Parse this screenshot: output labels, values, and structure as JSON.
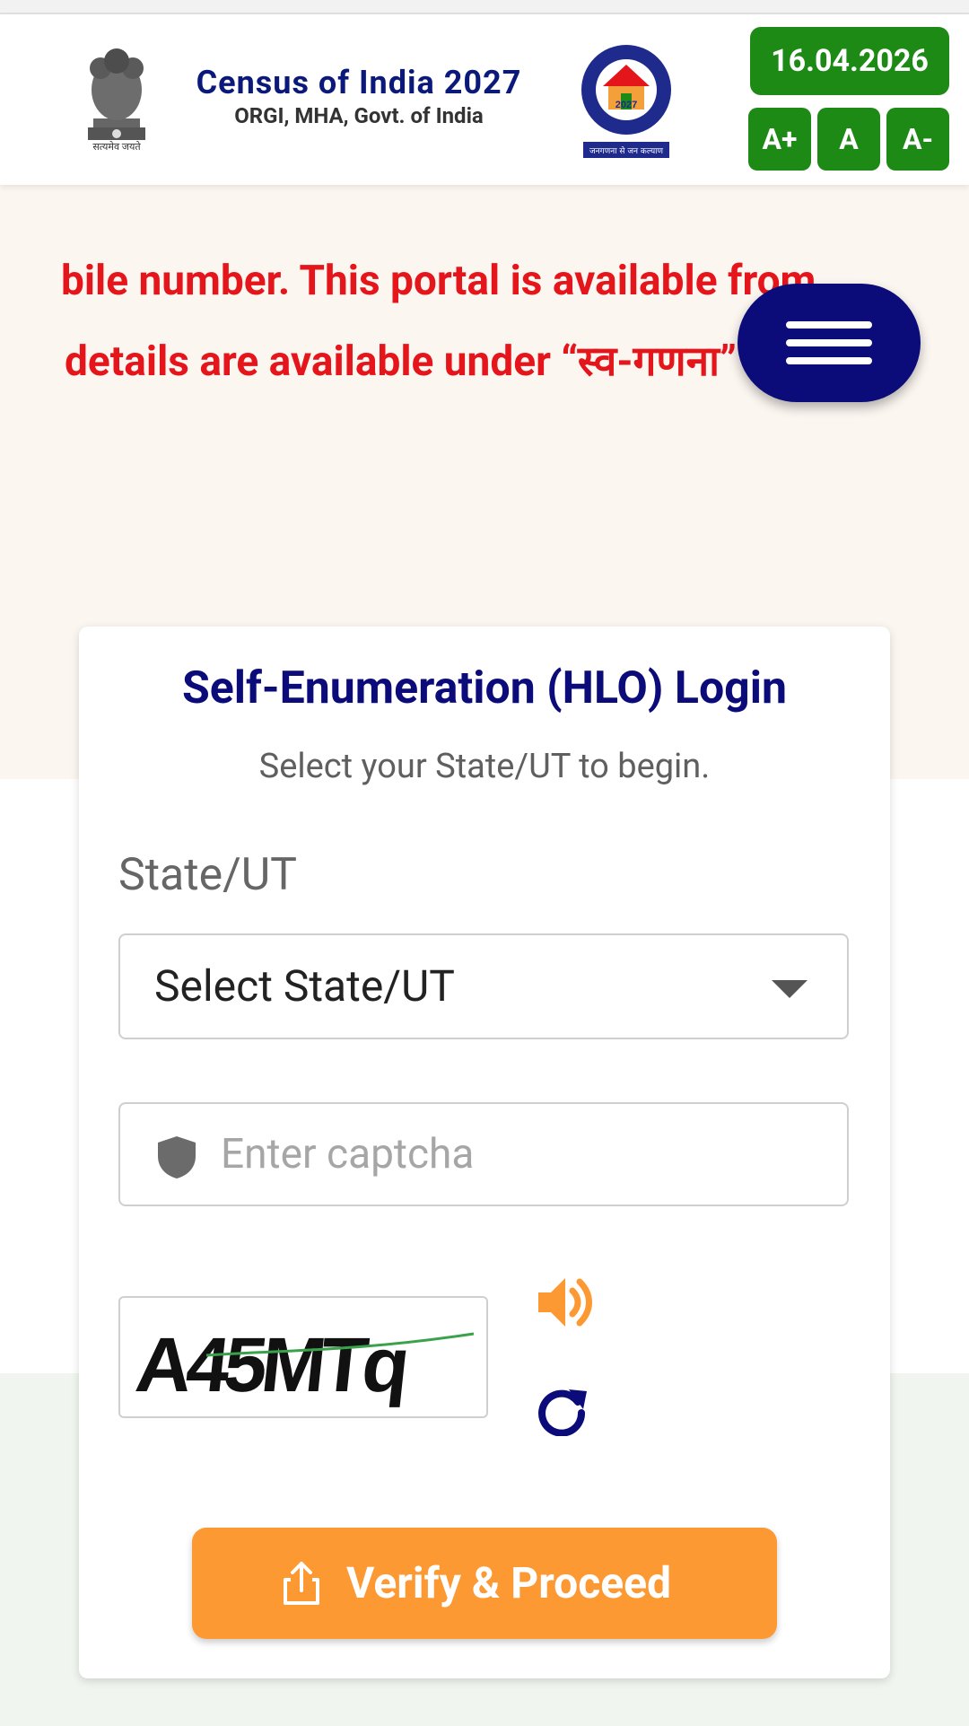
{
  "header": {
    "emblem_text": "सत्यमेव जयते",
    "title": "Census of India 2027",
    "subtitle": "ORGI, MHA, Govt. of India",
    "logo_year": "2027",
    "logo_ring_top": "भारत की जनगणना",
    "logo_ring_bottom": "CENSUS OF INDIA",
    "logo_tagline": "जनगणना से जन कल्याण",
    "date": "16.04.2026",
    "font_increase": "A+",
    "font_normal": "A",
    "font_decrease": "A-"
  },
  "banner": {
    "line1": "bile number. This portal is available from",
    "line2": "details are available under “स्व-गणना”"
  },
  "login": {
    "title": "Self-Enumeration (HLO) Login",
    "subtitle": "Select your State/UT to begin.",
    "state_label": "State/UT",
    "state_selected": "Select State/UT",
    "captcha_placeholder": "Enter captcha",
    "captcha_text": "A45MTq",
    "verify_label": "Verify & Proceed"
  },
  "colors": {
    "navy": "#0b0b7a",
    "green": "#1d8a16",
    "orange": "#fd9933",
    "red": "#e4151b"
  },
  "icons": [
    "menu-icon",
    "shield-icon",
    "audio-icon",
    "refresh-icon",
    "share-icon",
    "chevron-down-icon"
  ]
}
